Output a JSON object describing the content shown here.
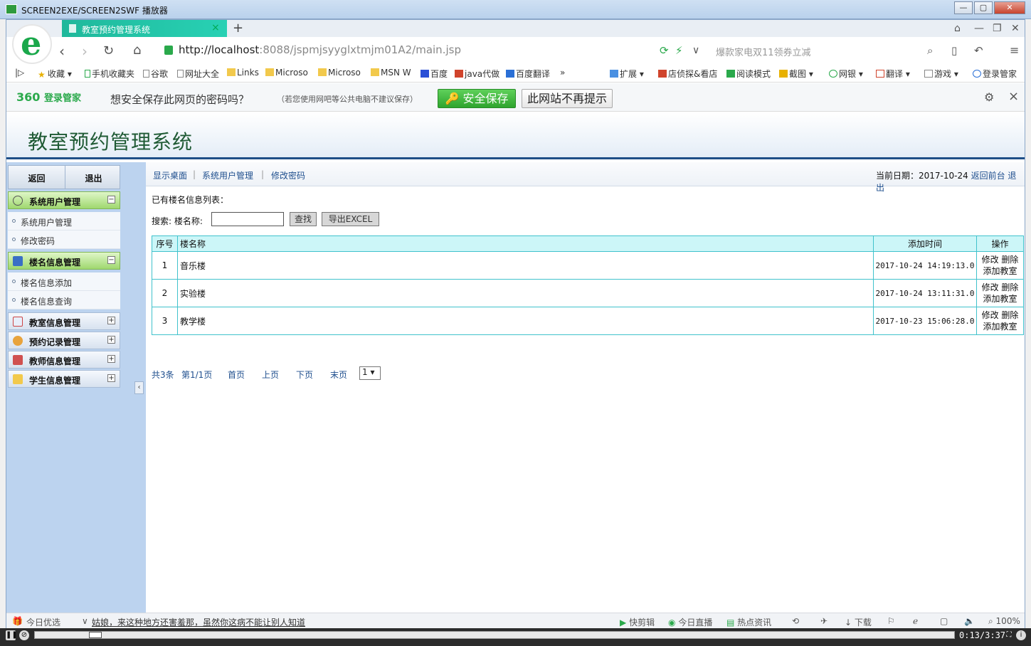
{
  "window": {
    "title": "SCREEN2EXE/SCREEN2SWF 播放器"
  },
  "browser": {
    "tab_label": "教室预约管理系统",
    "url_host": "http://localhost",
    "url_rest": ":8088/jspmjsyyglxtmjm01A2/main.jsp",
    "search_placeholder": "爆款家电双11领券立减",
    "bookmarks": [
      "收藏",
      "手机收藏夹",
      "谷歌",
      "网址大全",
      "Links",
      "Microso",
      "Microso",
      "MSN W",
      "百度",
      "java代做",
      "百度翻译"
    ],
    "extensions": [
      "扩展",
      "店侦探&看店",
      "阅读模式",
      "截图",
      "网银",
      "翻译",
      "游戏",
      "登录管家"
    ]
  },
  "password_bar": {
    "brand": "360",
    "brand_suffix": "登录管家",
    "question": "想安全保存此网页的密码吗？",
    "note": "（若您使用网吧等公共电脑不建议保存）",
    "save_label": "安全保存",
    "never_label": "此网站不再提示"
  },
  "app": {
    "title": "教室预约管理系统",
    "top_buttons": {
      "back": "返回",
      "logout": "退出"
    },
    "groups": [
      {
        "label": "系统用户管理",
        "expanded": true,
        "items": [
          "系统用户管理",
          "修改密码"
        ]
      },
      {
        "label": "楼名信息管理",
        "expanded": true,
        "items": [
          "楼名信息添加",
          "楼名信息查询"
        ]
      },
      {
        "label": "教室信息管理",
        "expanded": false
      },
      {
        "label": "预约记录管理",
        "expanded": false
      },
      {
        "label": "教师信息管理",
        "expanded": false
      },
      {
        "label": "学生信息管理",
        "expanded": false
      }
    ],
    "crumbs": [
      "显示桌面",
      "系统用户管理",
      "修改密码"
    ],
    "date_label": "当前日期：2017-10-24",
    "back_front": "返回前台",
    "exit": "退出"
  },
  "list": {
    "title": "已有楼名信息列表：",
    "search_label": "搜索:",
    "field_label": "楼名称:",
    "search_value": "",
    "find_button": "查找",
    "export_button": "导出EXCEL",
    "columns": [
      "序号",
      "楼名称",
      "添加时间",
      "操作"
    ],
    "rows": [
      {
        "no": "1",
        "name": "音乐楼",
        "time": "2017-10-24 14:19:13.0"
      },
      {
        "no": "2",
        "name": "实验楼",
        "time": "2017-10-24 13:11:31.0"
      },
      {
        "no": "3",
        "name": "教学楼",
        "time": "2017-10-23 15:06:28.0"
      }
    ],
    "ops": {
      "edit": "修改",
      "delete": "删除",
      "add_room": "添加教室"
    }
  },
  "pager": {
    "total": "共3条",
    "page": "第1/1页",
    "first": "首页",
    "prev": "上页",
    "next": "下页",
    "last": "末页",
    "selected": "1 ▾"
  },
  "statusbar": {
    "today": "今日优选",
    "headline": "姑娘，来这种地方还害羞那，虽然你这病不能让别人知道",
    "items": [
      "快剪辑",
      "今日直播",
      "热点资讯",
      "下载"
    ],
    "zoom": "100%"
  },
  "player": {
    "time": "0:13/3:37"
  }
}
